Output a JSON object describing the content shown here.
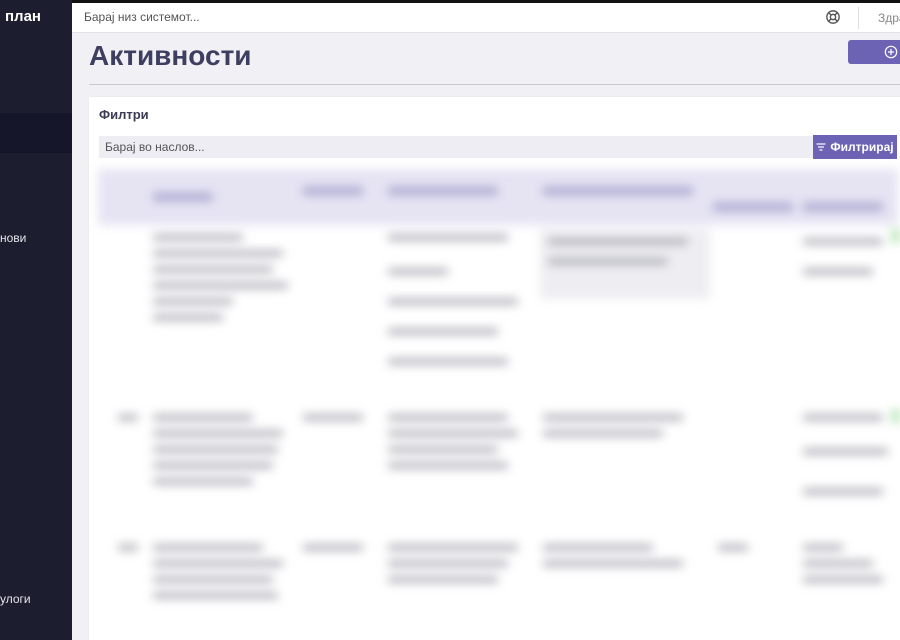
{
  "sidebar": {
    "brand": "план",
    "items": [
      {
        "label": "нови"
      },
      {
        "label": "улоги"
      }
    ]
  },
  "topbar": {
    "search_placeholder": "Барај низ системот...",
    "help_icon": "life-ring-icon",
    "user_greeting": "Здра"
  },
  "page": {
    "title": "Активности",
    "add_icon": "plus-circle-icon"
  },
  "filters": {
    "label": "Филтри",
    "title_placeholder": "Барај во наслов...",
    "filter_button": "Филтрирај",
    "filter_icon": "filter-icon"
  },
  "colors": {
    "sidebar_bg": "#1c1d2e",
    "accent": "#6c63b4",
    "title": "#3e3f60"
  }
}
